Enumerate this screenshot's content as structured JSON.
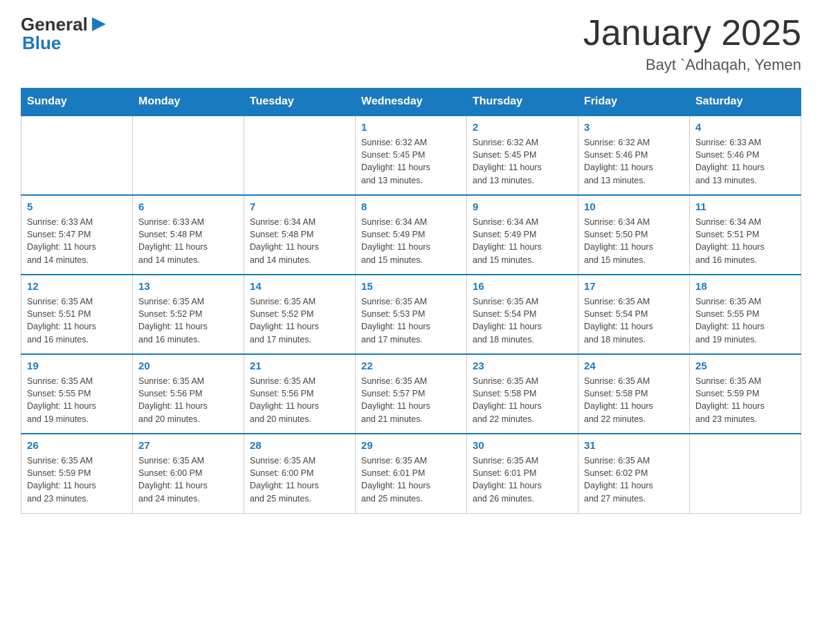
{
  "header": {
    "logo": {
      "text_general": "General",
      "text_blue": "Blue"
    },
    "title": "January 2025",
    "location": "Bayt `Adhaqah, Yemen"
  },
  "days_of_week": [
    "Sunday",
    "Monday",
    "Tuesday",
    "Wednesday",
    "Thursday",
    "Friday",
    "Saturday"
  ],
  "weeks": [
    [
      {
        "day": "",
        "info": ""
      },
      {
        "day": "",
        "info": ""
      },
      {
        "day": "",
        "info": ""
      },
      {
        "day": "1",
        "info": "Sunrise: 6:32 AM\nSunset: 5:45 PM\nDaylight: 11 hours\nand 13 minutes."
      },
      {
        "day": "2",
        "info": "Sunrise: 6:32 AM\nSunset: 5:45 PM\nDaylight: 11 hours\nand 13 minutes."
      },
      {
        "day": "3",
        "info": "Sunrise: 6:32 AM\nSunset: 5:46 PM\nDaylight: 11 hours\nand 13 minutes."
      },
      {
        "day": "4",
        "info": "Sunrise: 6:33 AM\nSunset: 5:46 PM\nDaylight: 11 hours\nand 13 minutes."
      }
    ],
    [
      {
        "day": "5",
        "info": "Sunrise: 6:33 AM\nSunset: 5:47 PM\nDaylight: 11 hours\nand 14 minutes."
      },
      {
        "day": "6",
        "info": "Sunrise: 6:33 AM\nSunset: 5:48 PM\nDaylight: 11 hours\nand 14 minutes."
      },
      {
        "day": "7",
        "info": "Sunrise: 6:34 AM\nSunset: 5:48 PM\nDaylight: 11 hours\nand 14 minutes."
      },
      {
        "day": "8",
        "info": "Sunrise: 6:34 AM\nSunset: 5:49 PM\nDaylight: 11 hours\nand 15 minutes."
      },
      {
        "day": "9",
        "info": "Sunrise: 6:34 AM\nSunset: 5:49 PM\nDaylight: 11 hours\nand 15 minutes."
      },
      {
        "day": "10",
        "info": "Sunrise: 6:34 AM\nSunset: 5:50 PM\nDaylight: 11 hours\nand 15 minutes."
      },
      {
        "day": "11",
        "info": "Sunrise: 6:34 AM\nSunset: 5:51 PM\nDaylight: 11 hours\nand 16 minutes."
      }
    ],
    [
      {
        "day": "12",
        "info": "Sunrise: 6:35 AM\nSunset: 5:51 PM\nDaylight: 11 hours\nand 16 minutes."
      },
      {
        "day": "13",
        "info": "Sunrise: 6:35 AM\nSunset: 5:52 PM\nDaylight: 11 hours\nand 16 minutes."
      },
      {
        "day": "14",
        "info": "Sunrise: 6:35 AM\nSunset: 5:52 PM\nDaylight: 11 hours\nand 17 minutes."
      },
      {
        "day": "15",
        "info": "Sunrise: 6:35 AM\nSunset: 5:53 PM\nDaylight: 11 hours\nand 17 minutes."
      },
      {
        "day": "16",
        "info": "Sunrise: 6:35 AM\nSunset: 5:54 PM\nDaylight: 11 hours\nand 18 minutes."
      },
      {
        "day": "17",
        "info": "Sunrise: 6:35 AM\nSunset: 5:54 PM\nDaylight: 11 hours\nand 18 minutes."
      },
      {
        "day": "18",
        "info": "Sunrise: 6:35 AM\nSunset: 5:55 PM\nDaylight: 11 hours\nand 19 minutes."
      }
    ],
    [
      {
        "day": "19",
        "info": "Sunrise: 6:35 AM\nSunset: 5:55 PM\nDaylight: 11 hours\nand 19 minutes."
      },
      {
        "day": "20",
        "info": "Sunrise: 6:35 AM\nSunset: 5:56 PM\nDaylight: 11 hours\nand 20 minutes."
      },
      {
        "day": "21",
        "info": "Sunrise: 6:35 AM\nSunset: 5:56 PM\nDaylight: 11 hours\nand 20 minutes."
      },
      {
        "day": "22",
        "info": "Sunrise: 6:35 AM\nSunset: 5:57 PM\nDaylight: 11 hours\nand 21 minutes."
      },
      {
        "day": "23",
        "info": "Sunrise: 6:35 AM\nSunset: 5:58 PM\nDaylight: 11 hours\nand 22 minutes."
      },
      {
        "day": "24",
        "info": "Sunrise: 6:35 AM\nSunset: 5:58 PM\nDaylight: 11 hours\nand 22 minutes."
      },
      {
        "day": "25",
        "info": "Sunrise: 6:35 AM\nSunset: 5:59 PM\nDaylight: 11 hours\nand 23 minutes."
      }
    ],
    [
      {
        "day": "26",
        "info": "Sunrise: 6:35 AM\nSunset: 5:59 PM\nDaylight: 11 hours\nand 23 minutes."
      },
      {
        "day": "27",
        "info": "Sunrise: 6:35 AM\nSunset: 6:00 PM\nDaylight: 11 hours\nand 24 minutes."
      },
      {
        "day": "28",
        "info": "Sunrise: 6:35 AM\nSunset: 6:00 PM\nDaylight: 11 hours\nand 25 minutes."
      },
      {
        "day": "29",
        "info": "Sunrise: 6:35 AM\nSunset: 6:01 PM\nDaylight: 11 hours\nand 25 minutes."
      },
      {
        "day": "30",
        "info": "Sunrise: 6:35 AM\nSunset: 6:01 PM\nDaylight: 11 hours\nand 26 minutes."
      },
      {
        "day": "31",
        "info": "Sunrise: 6:35 AM\nSunset: 6:02 PM\nDaylight: 11 hours\nand 27 minutes."
      },
      {
        "day": "",
        "info": ""
      }
    ]
  ],
  "colors": {
    "header_bg": "#1a7abf",
    "header_text": "#ffffff",
    "day_number": "#1a7abf",
    "border": "#cccccc",
    "row_border": "#1a7abf"
  }
}
